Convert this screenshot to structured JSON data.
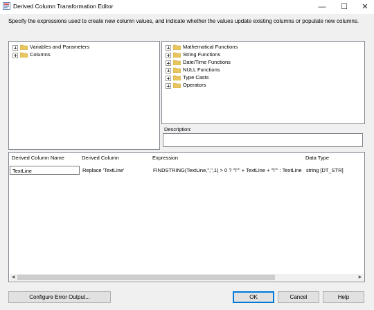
{
  "window": {
    "title": "Derived Column Transformation Editor",
    "instruction": "Specify the expressions used to create new column values, and indicate whether the values update existing columns or populate new columns."
  },
  "left_tree": {
    "items": [
      "Variables and Parameters",
      "Columns"
    ]
  },
  "right_tree": {
    "items": [
      "Mathematical Functions",
      "String Functions",
      "Date/Time Functions",
      "NULL Functions",
      "Type Casts",
      "Operators"
    ]
  },
  "description": {
    "label": "Description:"
  },
  "grid": {
    "headers": [
      "Derived Column Name",
      "Derived Column",
      "Expression",
      "Data Type"
    ],
    "rows": [
      [
        "TextLine",
        "Replace 'TextLine'",
        "FINDSTRING(TextLine,\",\",1) > 0 ? \"\\\"\" + TextLine + \"\\\"\" : TextLine",
        "string [DT_STR]"
      ]
    ]
  },
  "buttons": {
    "configure": "Configure Error Output...",
    "ok": "OK",
    "cancel": "Cancel",
    "help": "Help"
  },
  "window_buttons": {
    "minimize": "—",
    "maximize": "☐",
    "close": "✕"
  },
  "icons": {
    "folder_color": "#e8c65f",
    "default_button_border": "#0078d7"
  }
}
